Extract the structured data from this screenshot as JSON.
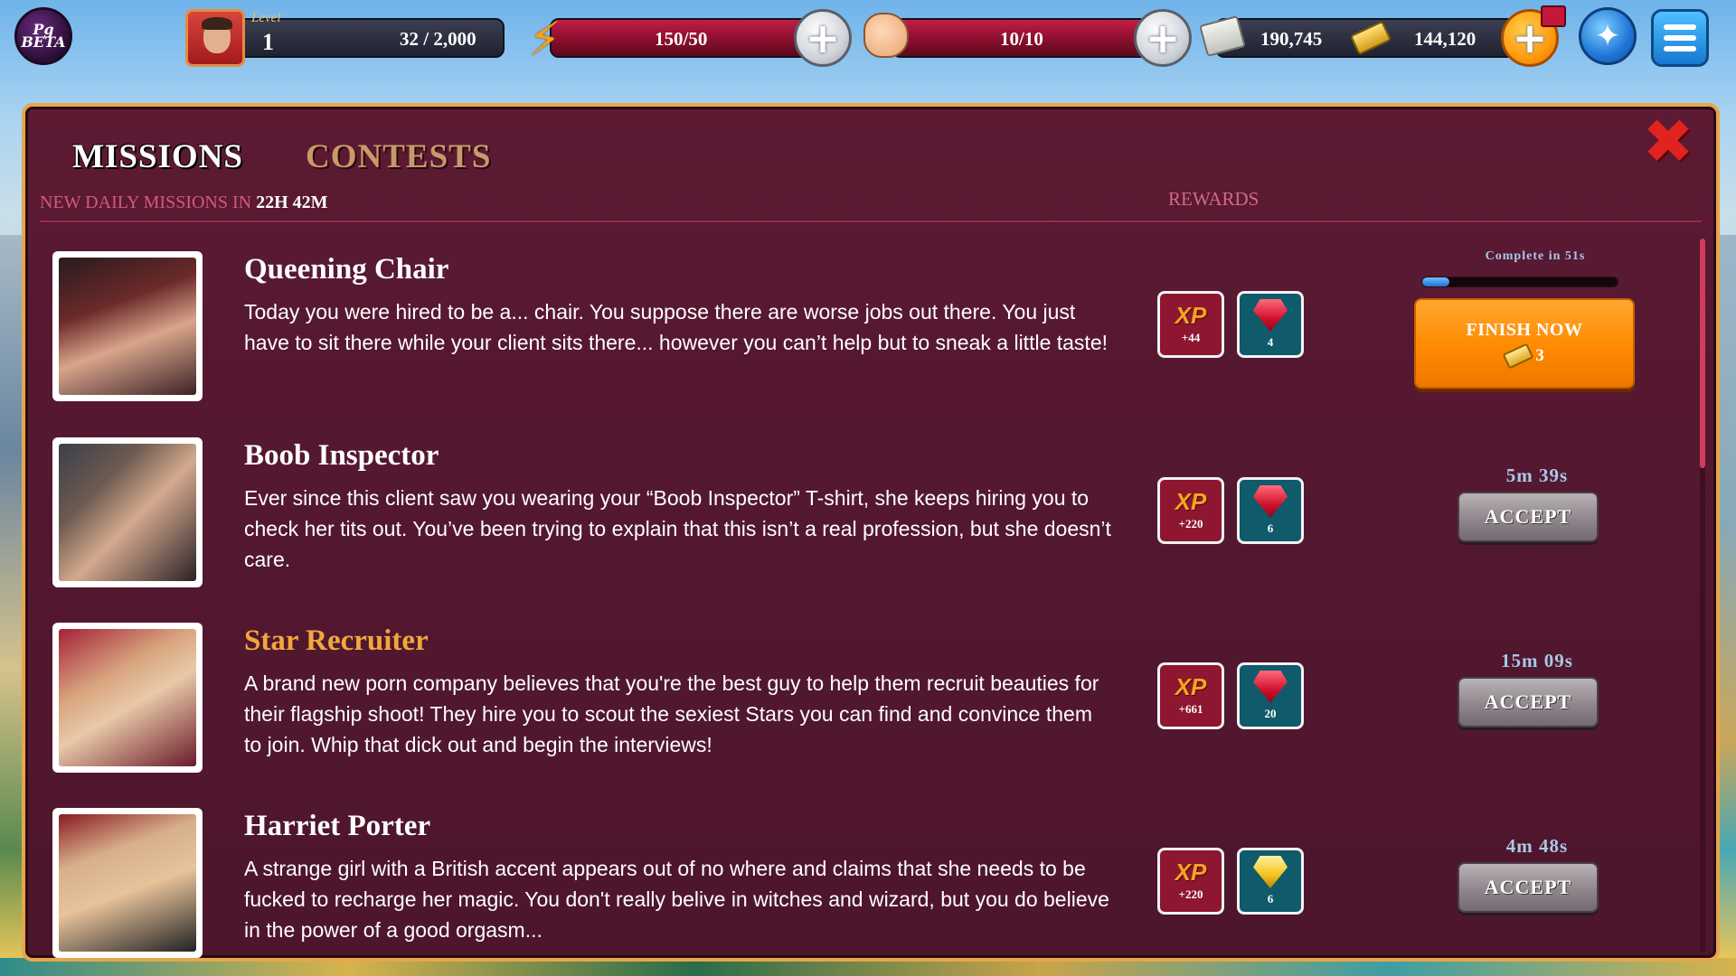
{
  "hud": {
    "logo_text": "Pg BETA",
    "level_label": "Level",
    "level": "1",
    "xp_progress": "32  / 2,000",
    "energy": "150/50",
    "fight": "10/10",
    "cash": "190,745",
    "gold": "144,120",
    "plus_symbol": "+",
    "wand_symbol": "✦"
  },
  "tabs": {
    "missions": "MISSIONS",
    "contests": "CONTESTS"
  },
  "close_symbol": "✖",
  "timer": {
    "label": "NEW DAILY MISSIONS IN ",
    "value": "22H 42M"
  },
  "rewards_header": "REWARDS",
  "xp_label": "XP",
  "missions": [
    {
      "title": "Queening Chair",
      "description": "Today you were hired to be a... chair. You suppose there are worse jobs out there. You just have to sit there while your client sits there... however you can’t help but to sneak a little taste!",
      "xp": "+44",
      "gems": "4",
      "gem_color": "red",
      "status": "in-progress",
      "complete_label": "Complete in 51s",
      "progress": 0.14,
      "finish_label": "FINISH NOW",
      "finish_cost": "3"
    },
    {
      "title": "Boob Inspector",
      "description": "Ever since this client saw you wearing your “Boob Inspector” T-shirt, she keeps hiring you to check her tits out. You’ve been trying to explain that this isn’t a real profession, but she doesn’t care.",
      "xp": "+220",
      "gems": "6",
      "gem_color": "red",
      "duration": "5m 39s",
      "accept_label": "ACCEPT"
    },
    {
      "title": "Star Recruiter",
      "description": "A brand new porn company believes that you're the best guy to help them recruit beauties for their flagship shoot! They hire you to scout the sexiest Stars you can find and convince them to join. Whip that dick out and begin the interviews!",
      "xp": "+661",
      "gems": "20",
      "gem_color": "red",
      "duration": "15m 09s",
      "accept_label": "ACCEPT",
      "title_color": "#f0a83c"
    },
    {
      "title": "Harriet Porter",
      "description": "A strange girl with a British accent appears out of no where and claims that she needs to be fucked to recharge her magic. You don't really belive in witches and wizard, but you do believe in the power of a good orgasm...",
      "xp": "+220",
      "gems": "6",
      "gem_color": "yellow",
      "duration": "4m 48s",
      "accept_label": "ACCEPT"
    }
  ]
}
